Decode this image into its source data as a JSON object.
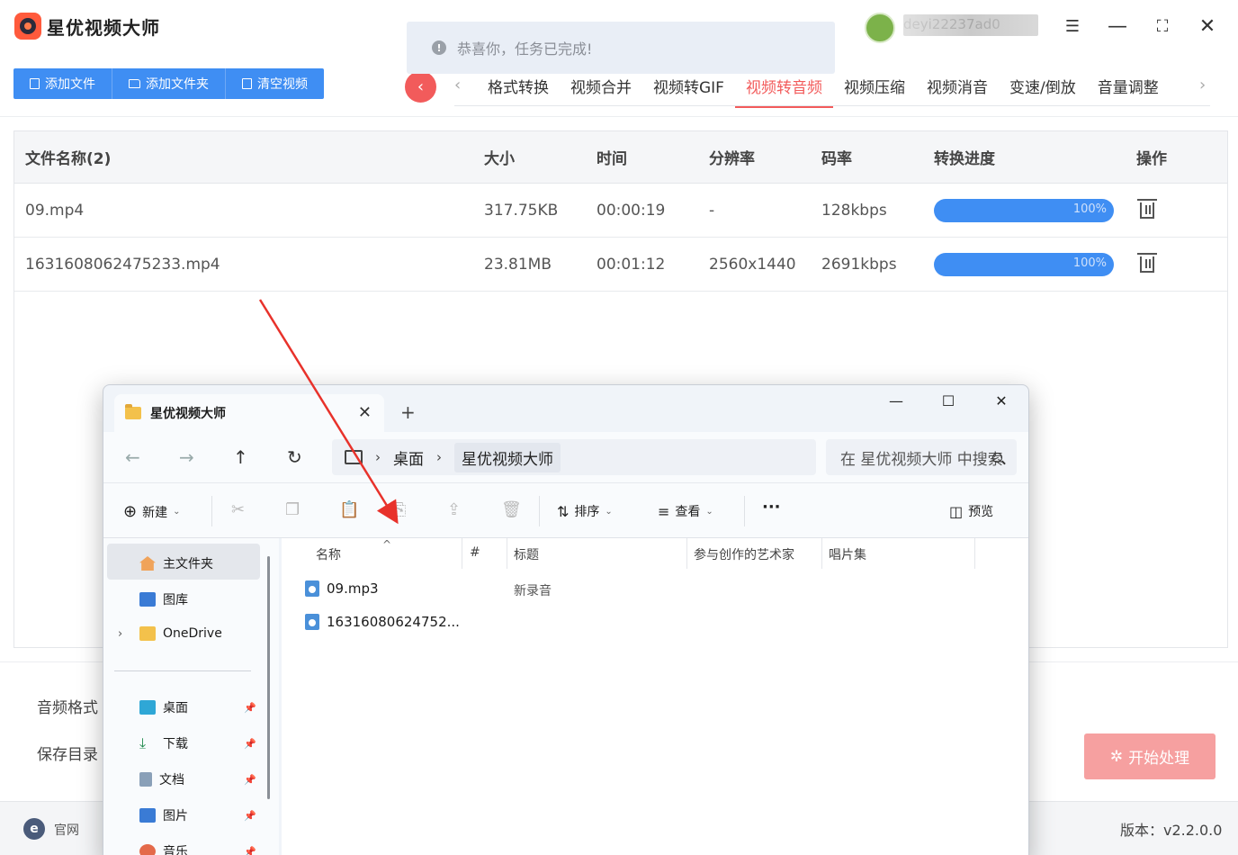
{
  "app": {
    "title": "星优视频大师",
    "toolbar": {
      "add_file": "添加文件",
      "add_folder": "添加文件夹",
      "clear": "清空视频"
    },
    "toast": "恭喜你，任务已完成!",
    "user": {
      "name": "deyi22237ad0"
    },
    "tabs": [
      "格式转换",
      "视频合并",
      "视频转GIF",
      "视频转音频",
      "视频压缩",
      "视频消音",
      "变速/倒放",
      "音量调整"
    ],
    "active_tab": "视频转音频",
    "colors": {
      "accent": "#3f8ef3",
      "tab_active": "#f25b5b",
      "start": "#f6a0a0"
    }
  },
  "table": {
    "headers": [
      "文件名称(2)",
      "大小",
      "时间",
      "分辨率",
      "码率",
      "转换进度",
      "操作"
    ],
    "rows": [
      {
        "name": "09.mp4",
        "size": "317.75KB",
        "time": "00:00:19",
        "resolution": "-",
        "bitrate": "128kbps",
        "progress_label": "100%",
        "progress": 1.0
      },
      {
        "name": "1631608062475233.mp4",
        "size": "23.81MB",
        "time": "00:01:12",
        "resolution": "2560x1440",
        "bitrate": "2691kbps",
        "progress_label": "100%",
        "progress": 1.0
      }
    ]
  },
  "bottom": {
    "audio_format_label": "音频格式",
    "save_dir_label": "保存目录",
    "start_button": "开始处理",
    "official_site": "官网",
    "version": "版本：v2.2.0.0"
  },
  "explorer": {
    "tab_title": "星优视频大师",
    "breadcrumb": [
      "桌面",
      "星优视频大师"
    ],
    "search_placeholder": "在 星优视频大师 中搜索",
    "commands": {
      "new": "新建",
      "sort": "排序",
      "view": "查看",
      "more": "···",
      "preview": "预览"
    },
    "sidebar": {
      "home": "主文件夹",
      "gallery": "图库",
      "onedrive": "OneDrive",
      "quick": [
        "桌面",
        "下载",
        "文档",
        "图片",
        "音乐"
      ]
    },
    "columns": [
      "名称",
      "#",
      "标题",
      "参与创作的艺术家",
      "唱片集"
    ],
    "files": [
      {
        "name": "09.mp3",
        "title": "新录音"
      },
      {
        "name": "16316080624752...",
        "title": ""
      }
    ]
  }
}
